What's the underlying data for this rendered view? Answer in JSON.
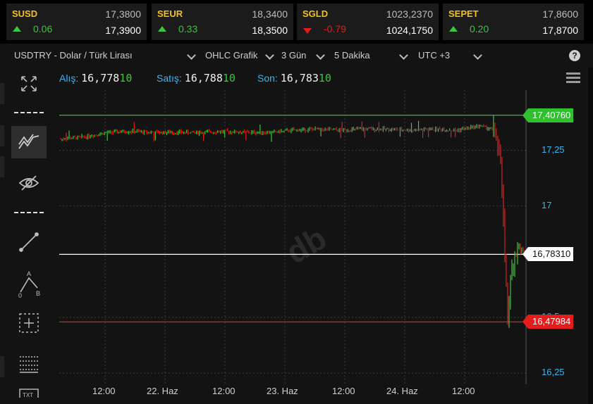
{
  "tickers": [
    {
      "symbol": "SUSD",
      "bid": "17,3800",
      "change": "0.06",
      "direction": "up",
      "ask": "17,3900"
    },
    {
      "symbol": "SEUR",
      "bid": "18,3400",
      "change": "0.33",
      "direction": "up",
      "ask": "18,3500"
    },
    {
      "symbol": "SGLD",
      "bid": "1023,2370",
      "change": "-0.79",
      "direction": "down",
      "ask": "1024,1750"
    },
    {
      "symbol": "SEPET",
      "bid": "17,8600",
      "change": "0.20",
      "direction": "up",
      "ask": "17,8700"
    }
  ],
  "selectors": {
    "instrument": "USDTRY - Dolar / Türk Lirası",
    "chart_type": "OHLC Grafik",
    "range": "3 Gün",
    "interval": "5 Dakika",
    "timezone": "UTC +3"
  },
  "help_icon": "question-circle-icon",
  "menu_icon": "hamburger-icon",
  "prices": {
    "bid_label": "Alış:",
    "bid_main": "16,778",
    "bid_tail": "10",
    "ask_label": "Satış:",
    "ask_main": "16,788",
    "ask_tail": "10",
    "last_label": "Son:",
    "last_main": "16,783",
    "last_tail": "10"
  },
  "tools": [
    "expand-icon",
    "line-style-icon",
    "indicators-icon",
    "hide-icon",
    "line-style-icon",
    "trend-line-icon",
    "abcd-pattern-icon",
    "crosshair-icon",
    "grid-icon",
    "text-icon"
  ],
  "tool_labels": {
    "pattern_a": "A",
    "pattern_b": "B",
    "pattern_zero": "0",
    "text": "TXT"
  },
  "colors": {
    "accent_blue": "#38b6f0",
    "up_green": "#3ec43e",
    "down_red": "#e51c1c",
    "ticker_symbol": "#f2c21b"
  },
  "watermark": "db",
  "chart_data": {
    "type": "ohlc",
    "symbol": "USDTRY",
    "interval": "5 Dakika",
    "ylim": [
      16.2,
      17.52
    ],
    "yticks": [
      "17,25",
      "17",
      "16,5",
      "16,25"
    ],
    "y_tick_values": [
      17.25,
      17.0,
      16.5,
      16.25
    ],
    "xticks": [
      "12:00",
      "22. Haz",
      "12:00",
      "23. Haz",
      "12:00",
      "24. Haz",
      "12:00"
    ],
    "grid": true,
    "levels": [
      {
        "name": "high",
        "value": 17.4076,
        "label": "17,40760",
        "color": "#2fbf2f"
      },
      {
        "name": "last",
        "value": 16.7831,
        "label": "16,78310",
        "color": "#ffffff"
      },
      {
        "name": "low",
        "value": 16.47984,
        "label": "16,47984",
        "color": "#e51c1c"
      }
    ],
    "series": {
      "x": [
        0,
        0.05,
        0.1,
        0.15,
        0.2,
        0.25,
        0.3,
        0.35,
        0.4,
        0.45,
        0.5,
        0.55,
        0.6,
        0.65,
        0.7,
        0.75,
        0.8,
        0.85,
        0.9,
        0.935,
        0.945,
        0.95,
        0.955,
        0.96,
        0.965,
        0.97,
        0.975,
        0.985,
        1.0
      ],
      "y": [
        17.3,
        17.31,
        17.33,
        17.335,
        17.33,
        17.33,
        17.33,
        17.335,
        17.33,
        17.33,
        17.34,
        17.345,
        17.34,
        17.345,
        17.345,
        17.34,
        17.345,
        17.34,
        17.36,
        17.34,
        17.2,
        16.97,
        16.77,
        16.5,
        16.62,
        16.72,
        16.79,
        16.82,
        16.78
      ]
    }
  }
}
